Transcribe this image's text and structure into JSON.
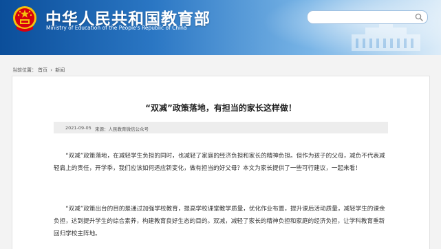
{
  "header": {
    "title": "中华人民共和国教育部",
    "subtitle": "Ministry of Education of the People's Republic of China",
    "search": {
      "placeholder": "",
      "value": ""
    }
  },
  "breadcrumb": {
    "prefix": "当前位置：",
    "items": [
      "首页",
      "新闻"
    ],
    "separator": "›"
  },
  "article": {
    "title": "“双减”政策落地，有担当的家长这样做！",
    "date": "2021-09-05",
    "source": "来源：人民教育微信公众号",
    "paragraphs": [
      "“双减”政策落地，在减轻学生负担的同时，也减轻了家庭的经济负担和家长的精神负担。但作为孩子的父母，减负不代表减轻肩上的责任，开学季，我们应该如何适应新变化，做有担当的好父母？本文为家长提供了一些可行建议，一起来看！",
      "“双减”政策出台的目的是通过加强学校教育，提高学校课堂教学质量，优化作业布置，提升课后活动质量，减轻学生的课余负担，达到提升学生的综合素养，构建教育良好生态的目的。双减，减轻了家长的精神负担和家庭的经济负担，让学科教育重新回归学校主阵地。"
    ]
  },
  "colors": {
    "header_blue": "#0b4e9a",
    "emblem_red": "#d7000f",
    "emblem_gold": "#f4c20d"
  }
}
